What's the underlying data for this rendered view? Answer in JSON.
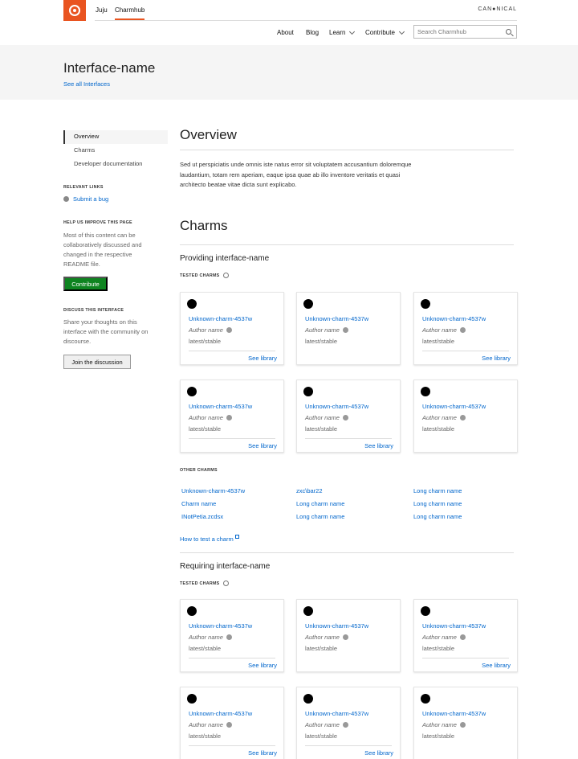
{
  "nav": {
    "juju": "Juju",
    "charmhub": "Charmhub",
    "brand": "CAN●NICAL",
    "about": "About",
    "blog": "Blog",
    "learn": "Learn",
    "contribute": "Contribute",
    "search_placeholder": "Search Charmhub"
  },
  "hero": {
    "title": "Interface-name",
    "link": "See all Interfaces"
  },
  "sidebar": {
    "items": [
      "Overview",
      "Charms",
      "Developer documentation"
    ],
    "relevant_links_caption": "RELEVANT LINKS",
    "submit_bug": "Submit a bug",
    "improve_caption": "HELP US IMPROVE THIS PAGE",
    "improve_text": "Most of this content can be collaboratively discussed and changed in the respective README file.",
    "contribute_button": "Contribute",
    "discuss_caption": "DISCUSS THIS INTERFACE",
    "discuss_text": "Share your thoughts on this interface with the community on discourse.",
    "discuss_button": "Join the discussion"
  },
  "overview": {
    "title": "Overview",
    "text": "Sed ut perspiciatis unde omnis iste natus error sit voluptatem accusantium doloremque laudantium, totam rem aperiam, eaque ipsa quae ab illo inventore veritatis et quasi architecto beatae vitae dicta sunt explicabo."
  },
  "charms": {
    "title": "Charms",
    "providing_title": "Providing interface-name",
    "requiring_title": "Requiring interface-name",
    "tested_caption": "TESTED CHARMS",
    "card": {
      "name": "Unknown-charm-4537w",
      "author": "Author name",
      "channel": "latest/stable",
      "library": "See library"
    },
    "other_caption": "OTHER CHARMS",
    "other": [
      "Unknown-charm-4537w",
      "zxc\\bar22",
      "Long charm name",
      "Charm name",
      "Long charm name",
      "Long charm name",
      "INotPetia.zcdsx",
      "Long charm name",
      "Long charm name"
    ],
    "how_to": "How to test a charm"
  }
}
